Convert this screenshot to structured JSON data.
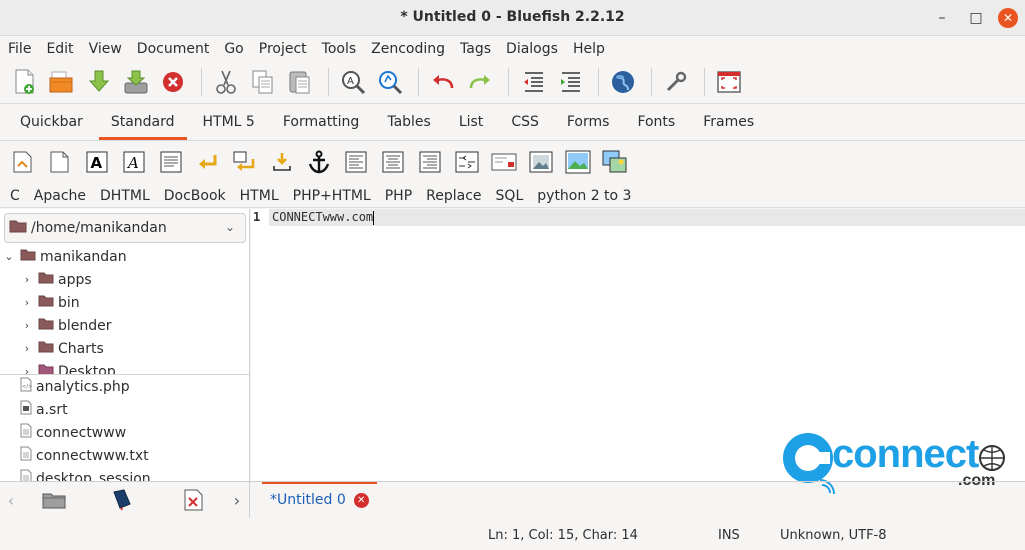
{
  "window": {
    "title": "* Untitled 0 - Bluefish 2.2.12",
    "minimize": "–",
    "maximize": "□",
    "close": "✕"
  },
  "menu": [
    "File",
    "Edit",
    "View",
    "Document",
    "Go",
    "Project",
    "Tools",
    "Zencoding",
    "Tags",
    "Dialogs",
    "Help"
  ],
  "main_toolbar": [
    {
      "name": "new-file-icon"
    },
    {
      "name": "open-file-icon"
    },
    {
      "name": "save-icon"
    },
    {
      "name": "save-as-icon"
    },
    {
      "name": "close-file-icon"
    },
    {
      "name": "cut-icon"
    },
    {
      "name": "copy-icon"
    },
    {
      "name": "paste-icon"
    },
    {
      "name": "find-icon"
    },
    {
      "name": "replace-icon"
    },
    {
      "name": "undo-icon"
    },
    {
      "name": "redo-icon"
    },
    {
      "name": "unindent-icon"
    },
    {
      "name": "indent-icon"
    },
    {
      "name": "preview-browser-icon"
    },
    {
      "name": "preferences-icon"
    },
    {
      "name": "fullscreen-icon"
    }
  ],
  "tabs": [
    "Quickbar",
    "Standard",
    "HTML 5",
    "Formatting",
    "Tables",
    "List",
    "CSS",
    "Forms",
    "Fonts",
    "Frames"
  ],
  "active_tab": "Standard",
  "tag_toolbar": [
    {
      "name": "quickstart-icon"
    },
    {
      "name": "body-icon"
    },
    {
      "name": "bold-icon",
      "glyph": "A"
    },
    {
      "name": "italic-icon",
      "glyph": "A"
    },
    {
      "name": "paragraph-icon"
    },
    {
      "name": "break-icon"
    },
    {
      "name": "break-clear-icon"
    },
    {
      "name": "nbsp-icon"
    },
    {
      "name": "anchor-icon"
    },
    {
      "name": "align-left-icon"
    },
    {
      "name": "align-center-icon"
    },
    {
      "name": "align-right-icon"
    },
    {
      "name": "comment-icon"
    },
    {
      "name": "email-icon"
    },
    {
      "name": "image-icon"
    },
    {
      "name": "thumbnail-icon"
    },
    {
      "name": "multi-thumbnail-icon"
    }
  ],
  "snippets": [
    "C",
    "Apache",
    "DHTML",
    "DocBook",
    "HTML",
    "PHP+HTML",
    "PHP",
    "Replace",
    "SQL",
    "python 2 to 3"
  ],
  "sidepanel": {
    "path": "/home/manikandan",
    "tree": [
      {
        "label": "manikandan",
        "expanded": true,
        "level": 0
      },
      {
        "label": "apps",
        "level": 1
      },
      {
        "label": "bin",
        "level": 1
      },
      {
        "label": "blender",
        "level": 1
      },
      {
        "label": "Charts",
        "level": 1
      },
      {
        "label": "Desktop",
        "level": 1
      }
    ],
    "files": [
      {
        "label": "analytics.php",
        "icon": "php-file-icon"
      },
      {
        "label": "a.srt",
        "icon": "text-file-icon"
      },
      {
        "label": "connectwww",
        "icon": "text-file-icon"
      },
      {
        "label": "connectwww.txt",
        "icon": "text-file-icon"
      },
      {
        "label": "desktop_session",
        "icon": "text-file-icon"
      }
    ]
  },
  "editor": {
    "line_number": "1",
    "text": "CONNECTwww.com"
  },
  "document_tab": {
    "label": "*Untitled 0"
  },
  "watermark": {
    "text_main": "connect",
    "text_sub": ".com"
  },
  "status": {
    "position": "Ln: 1, Col: 15, Char: 14",
    "mode": "INS",
    "encoding": "Unknown, UTF-8"
  },
  "colors": {
    "accent": "#e95420",
    "doc_tab_text": "#1d5fb8",
    "logo_blue": "#1ea0e6"
  }
}
